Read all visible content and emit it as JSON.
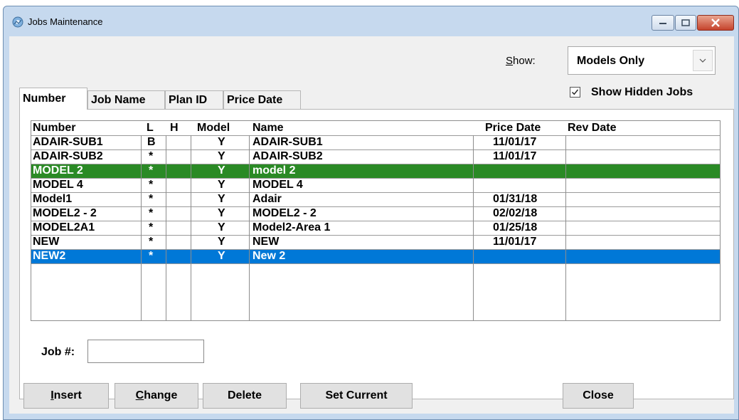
{
  "window": {
    "title": "Jobs Maintenance"
  },
  "show": {
    "label_prefix": "S",
    "label_rest": "how:",
    "selected": "Models Only"
  },
  "show_hidden": {
    "label": "Show Hidden Jobs",
    "checked": true
  },
  "tabs": [
    {
      "label": "Number",
      "active": true
    },
    {
      "label": "Job Name",
      "active": false
    },
    {
      "label": "Plan ID",
      "active": false
    },
    {
      "label": "Price Date",
      "active": false
    }
  ],
  "table": {
    "columns": [
      "Number",
      "L",
      "H",
      "Model",
      "Name",
      "Price Date",
      "Rev Date"
    ],
    "rows": [
      {
        "number": "ADAIR-SUB1",
        "l": "B",
        "h": "",
        "model": "Y",
        "name": "ADAIR-SUB1",
        "price_date": "11/01/17",
        "rev_date": ""
      },
      {
        "number": "ADAIR-SUB2",
        "l": "*",
        "h": "",
        "model": "Y",
        "name": "ADAIR-SUB2",
        "price_date": "11/01/17",
        "rev_date": ""
      },
      {
        "number": "MODEL 2",
        "l": "*",
        "h": "",
        "model": "Y",
        "name": "model 2",
        "price_date": "",
        "rev_date": "",
        "highlight": "green"
      },
      {
        "number": "MODEL 4",
        "l": "*",
        "h": "",
        "model": "Y",
        "name": "MODEL 4",
        "price_date": "",
        "rev_date": ""
      },
      {
        "number": "Model1",
        "l": "*",
        "h": "",
        "model": "Y",
        "name": "Adair",
        "price_date": "01/31/18",
        "rev_date": ""
      },
      {
        "number": "MODEL2 - 2",
        "l": "*",
        "h": "",
        "model": "Y",
        "name": "MODEL2 - 2",
        "price_date": "02/02/18",
        "rev_date": ""
      },
      {
        "number": "MODEL2A1",
        "l": "*",
        "h": "",
        "model": "Y",
        "name": "Model2-Area 1",
        "price_date": "01/25/18",
        "rev_date": ""
      },
      {
        "number": "NEW",
        "l": "*",
        "h": "",
        "model": "Y",
        "name": "NEW",
        "price_date": "11/01/17",
        "rev_date": ""
      },
      {
        "number": "NEW2",
        "l": "*",
        "h": "",
        "model": "Y",
        "name": "New 2",
        "price_date": "",
        "rev_date": "",
        "highlight": "blue"
      }
    ]
  },
  "job_no": {
    "label": "Job #:",
    "value": ""
  },
  "buttons": {
    "insert": {
      "mnemonic": "I",
      "rest": "nsert"
    },
    "change": {
      "mnemonic": "C",
      "rest": "hange"
    },
    "delete": {
      "label": "Delete"
    },
    "set_current": {
      "label": "Set Current"
    },
    "close": {
      "label": "Close"
    }
  },
  "colors": {
    "green_highlight": "#2a8a25",
    "blue_highlight": "#0078d7",
    "close_button": "#c5432c"
  }
}
